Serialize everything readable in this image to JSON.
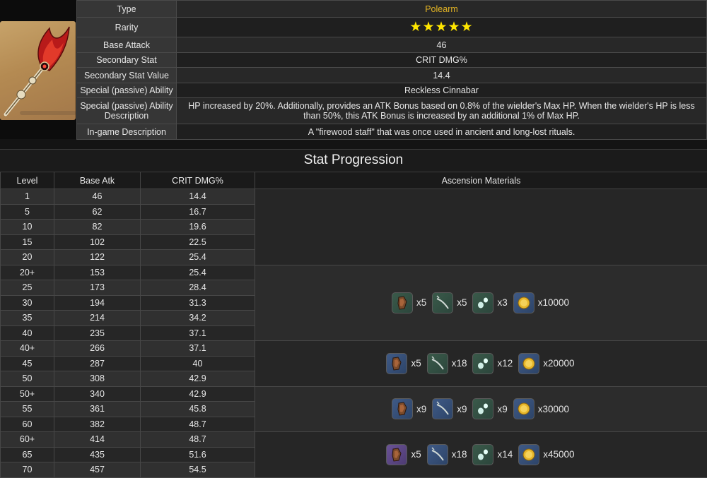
{
  "info": {
    "rows": [
      {
        "label": "Type",
        "value": "Polearm"
      },
      {
        "label": "Rarity",
        "value": "★★★★★"
      },
      {
        "label": "Base Attack",
        "value": "46"
      },
      {
        "label": "Secondary Stat",
        "value": "CRIT DMG%"
      },
      {
        "label": "Secondary Stat Value",
        "value": "14.4"
      },
      {
        "label": "Special (passive) Ability",
        "value": "Reckless Cinnabar"
      },
      {
        "label": "Special (passive) Ability Description",
        "value": "HP increased by 20%. Additionally, provides an ATK Bonus based on 0.8% of the wielder's Max HP. When the wielder's HP is less than 50%, this ATK Bonus is increased by an additional 1% of Max HP."
      },
      {
        "label": "In-game Description",
        "value": "A \"firewood staff\" that was once used in ancient and long-lost rituals."
      }
    ]
  },
  "progression": {
    "title": "Stat Progression",
    "headers": [
      "Level",
      "Base Atk",
      "CRIT DMG%",
      "Ascension Materials"
    ],
    "rows": [
      [
        "1",
        "46",
        "14.4"
      ],
      [
        "5",
        "62",
        "16.7"
      ],
      [
        "10",
        "82",
        "19.6"
      ],
      [
        "15",
        "102",
        "22.5"
      ],
      [
        "20",
        "122",
        "25.4"
      ],
      [
        "20+",
        "153",
        "25.4"
      ],
      [
        "25",
        "173",
        "28.4"
      ],
      [
        "30",
        "194",
        "31.3"
      ],
      [
        "35",
        "214",
        "34.2"
      ],
      [
        "40",
        "235",
        "37.1"
      ],
      [
        "40+",
        "266",
        "37.1"
      ],
      [
        "45",
        "287",
        "40"
      ],
      [
        "50",
        "308",
        "42.9"
      ],
      [
        "50+",
        "340",
        "42.9"
      ],
      [
        "55",
        "361",
        "45.8"
      ],
      [
        "60",
        "382",
        "48.7"
      ],
      [
        "60+",
        "414",
        "48.7"
      ],
      [
        "65",
        "435",
        "51.6"
      ],
      [
        "70",
        "457",
        "54.5"
      ]
    ],
    "materials": [
      {
        "items": []
      },
      {
        "items": [
          {
            "icon": "relic-fragment-icon",
            "tier": "r2",
            "qty": "x5"
          },
          {
            "icon": "claw-material-icon",
            "tier": "r2",
            "qty": "x5"
          },
          {
            "icon": "slime-drop-icon",
            "tier": "r2",
            "qty": "x3"
          },
          {
            "icon": "mora-coin-icon",
            "tier": "gold",
            "qty": "x10000"
          }
        ]
      },
      {
        "items": [
          {
            "icon": "relic-fragment-icon",
            "tier": "r3",
            "qty": "x5"
          },
          {
            "icon": "claw-material-icon",
            "tier": "r2",
            "qty": "x18"
          },
          {
            "icon": "slime-drop-icon",
            "tier": "r2",
            "qty": "x12"
          },
          {
            "icon": "mora-coin-icon",
            "tier": "gold",
            "qty": "x20000"
          }
        ]
      },
      {
        "items": [
          {
            "icon": "relic-fragment-icon",
            "tier": "r3",
            "qty": "x9"
          },
          {
            "icon": "claw-material-icon",
            "tier": "r3",
            "qty": "x9"
          },
          {
            "icon": "slime-drop-icon",
            "tier": "r2",
            "qty": "x9"
          },
          {
            "icon": "mora-coin-icon",
            "tier": "gold",
            "qty": "x30000"
          }
        ]
      },
      {
        "items": [
          {
            "icon": "relic-fragment-icon",
            "tier": "r4",
            "qty": "x5"
          },
          {
            "icon": "claw-material-icon",
            "tier": "r3",
            "qty": "x18"
          },
          {
            "icon": "slime-drop-icon",
            "tier": "r2",
            "qty": "x14"
          },
          {
            "icon": "mora-coin-icon",
            "tier": "gold",
            "qty": "x45000"
          }
        ]
      }
    ]
  },
  "colors": {
    "accent": "#e3b424",
    "star": "#ffe600",
    "background": "#141414"
  }
}
